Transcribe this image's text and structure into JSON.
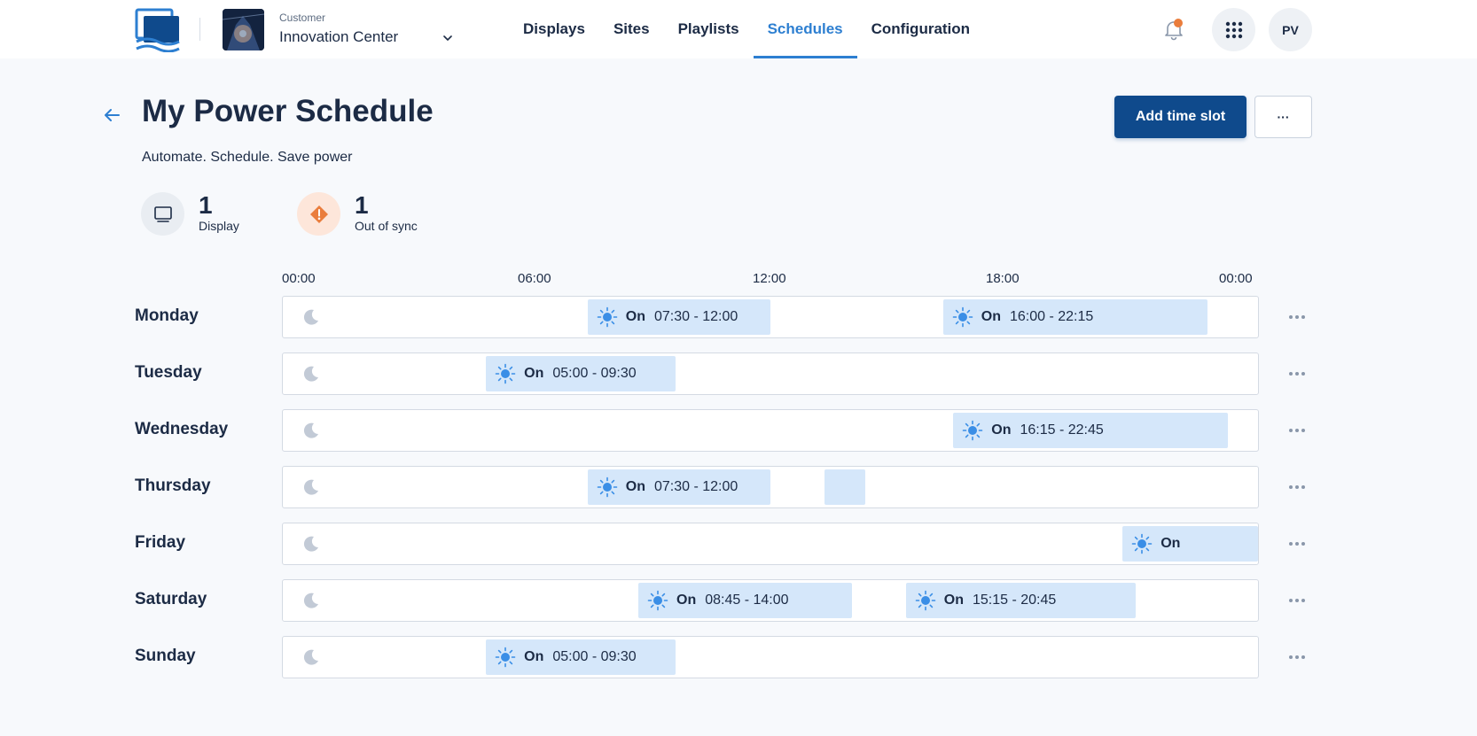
{
  "header": {
    "customer_label": "Customer",
    "customer_name": "Innovation Center",
    "nav": [
      "Displays",
      "Sites",
      "Playlists",
      "Schedules",
      "Configuration"
    ],
    "active_nav": "Schedules",
    "user_initials": "PV"
  },
  "page": {
    "title": "My Power Schedule",
    "subtitle": "Automate. Schedule. Save power",
    "add_button": "Add time slot",
    "more_button": "···"
  },
  "stats": [
    {
      "value": "1",
      "label": "Display"
    },
    {
      "value": "1",
      "label": "Out of sync"
    }
  ],
  "timeline": {
    "ticks": [
      "00:00",
      "06:00",
      "12:00",
      "18:00",
      "00:00"
    ],
    "on_label": "On",
    "days": [
      {
        "name": "Monday",
        "slots": [
          {
            "start": "07:30",
            "end": "12:00",
            "text": "07:30 - 12:00"
          },
          {
            "start": "16:15",
            "end": "22:45",
            "text": "16:00 - 22:15"
          }
        ]
      },
      {
        "name": "Tuesday",
        "slots": [
          {
            "start": "05:00",
            "end": "09:40",
            "text": "05:00 - 09:30"
          }
        ]
      },
      {
        "name": "Wednesday",
        "slots": [
          {
            "start": "16:30",
            "end": "23:15",
            "text": "16:15 - 22:45"
          }
        ]
      },
      {
        "name": "Thursday",
        "slots": [
          {
            "start": "07:30",
            "end": "12:00",
            "text": "07:30 - 12:00"
          },
          {
            "start": "13:20",
            "end": "14:20",
            "text": ""
          }
        ]
      },
      {
        "name": "Friday",
        "slots": [
          {
            "start": "20:40",
            "end": "24:00",
            "text": ""
          }
        ]
      },
      {
        "name": "Saturday",
        "slots": [
          {
            "start": "08:45",
            "end": "14:00",
            "text": "08:45 - 14:00"
          },
          {
            "start": "15:20",
            "end": "21:00",
            "text": "15:15 - 20:45"
          }
        ]
      },
      {
        "name": "Sunday",
        "slots": [
          {
            "start": "05:00",
            "end": "09:40",
            "text": "05:00 - 09:30"
          }
        ]
      }
    ]
  },
  "colors": {
    "primary": "#0f4a8c",
    "accent": "#2d7fd1",
    "slot_fill": "#d5e7fa",
    "sun": "#3a8ee6",
    "notification": "#ea7d3c",
    "warning": "#ea7d3c"
  },
  "icons": {
    "logo": "screens-logo",
    "back": "arrow-left-icon",
    "bell": "bell-icon",
    "apps": "grid-dots-icon",
    "display": "monitor-icon",
    "sync": "warning-diamond-icon",
    "moon": "moon-icon",
    "sun": "sun-icon",
    "row_menu": "ellipsis-icon"
  }
}
